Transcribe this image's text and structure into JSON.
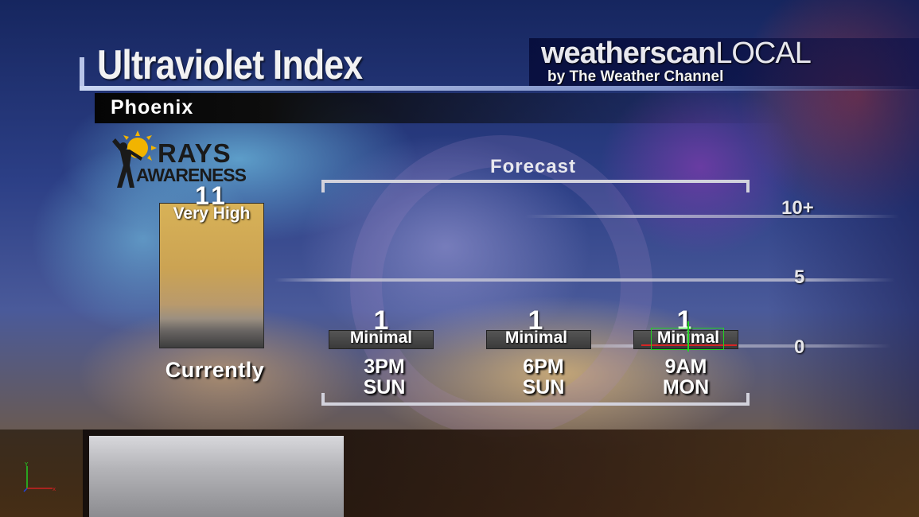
{
  "header": {
    "title": "Ultraviolet Index",
    "brand": {
      "bold": "weatherscan",
      "light": "LOCAL",
      "sub": "by The Weather Channel"
    }
  },
  "location": "Phoenix",
  "logo": {
    "line1": "RAYS",
    "line2": "AWARENESS"
  },
  "forecast_label": "Forecast",
  "scale": {
    "max_label": "10+",
    "mid_label": "5",
    "min_label": "0"
  },
  "current": {
    "value": "11",
    "category": "Very High",
    "label": "Currently",
    "level_fraction": 1.0
  },
  "forecast": [
    {
      "value": "1",
      "category": "Minimal",
      "time": "3PM",
      "day": "SUN"
    },
    {
      "value": "1",
      "category": "Minimal",
      "time": "6PM",
      "day": "SUN"
    },
    {
      "value": "1",
      "category": "Minimal",
      "time": "9AM",
      "day": "MON"
    }
  ],
  "colors": {
    "very_high": "#d8b257",
    "minimal": "#444444",
    "bracket": "#d2d2dc"
  },
  "icons": {
    "logo_icon": "sun-figure-icon",
    "gizmo": "axes-gizmo-icon"
  }
}
